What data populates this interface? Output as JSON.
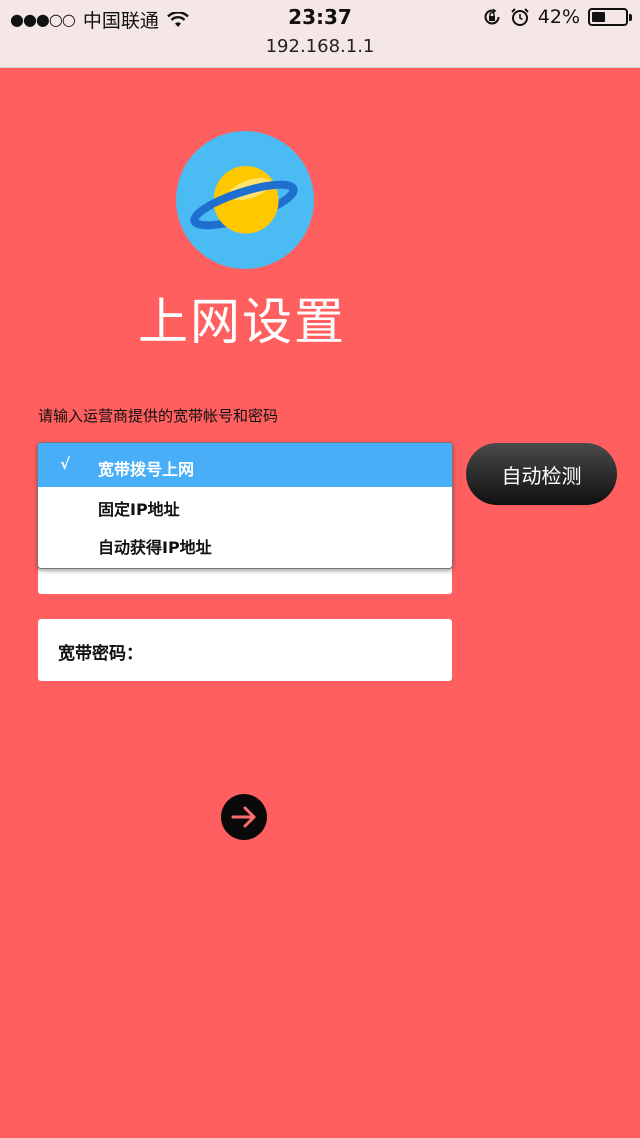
{
  "status_bar": {
    "signal": "●●●○○",
    "carrier": "中国联通",
    "time": "23:37",
    "battery_percent": "42%",
    "battery_level": 0.42
  },
  "browser": {
    "url": "192.168.1.1"
  },
  "header": {
    "title": "上网设置"
  },
  "form": {
    "hint": "请输入运营商提供的宽带帐号和密码",
    "dropdown": {
      "check_mark": "√",
      "options": [
        {
          "label": "宽带拨号上网",
          "selected": true
        },
        {
          "label": "固定IP地址",
          "selected": false
        },
        {
          "label": "自动获得IP地址",
          "selected": false
        }
      ]
    },
    "password_label": "宽带密码："
  },
  "buttons": {
    "auto_detect": "自动检测",
    "next_icon": "arrow-right-icon"
  },
  "colors": {
    "background": "#ff5f5f",
    "accent": "#47aef7",
    "logo_bg": "#4bbcf3",
    "planet": "#ffc800",
    "ring": "#1e6fcf"
  }
}
